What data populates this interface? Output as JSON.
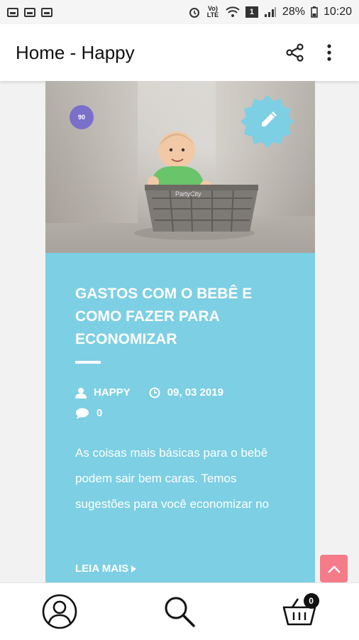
{
  "status_bar": {
    "battery": "28%",
    "time": "10:20",
    "volte": "Vo) LTE",
    "sim": "1"
  },
  "app_bar": {
    "title": "Home - Happy",
    "share_icon": "share-icon",
    "menu_icon": "more-vertical-icon"
  },
  "post": {
    "title": "GASTOS COM O BEBÊ E COMO FAZER PARA ECONOMIZAR",
    "author": "HAPPY",
    "date": "09, 03 2019",
    "comments": "0",
    "excerpt": "As coisas mais básicas para o bebê podem sair bem caras. Temos sugestões para você economizar no",
    "read_more": "LEIA MAIS",
    "image_badge": "90",
    "basket_label": "PartyCity",
    "card_color": "#7dcfe3"
  },
  "bottom_nav": {
    "cart_count": "0",
    "items": [
      "account-icon",
      "search-icon",
      "cart-icon"
    ]
  },
  "colors": {
    "scroll_top": "#f47b88",
    "accent": "#7dcfe3"
  }
}
